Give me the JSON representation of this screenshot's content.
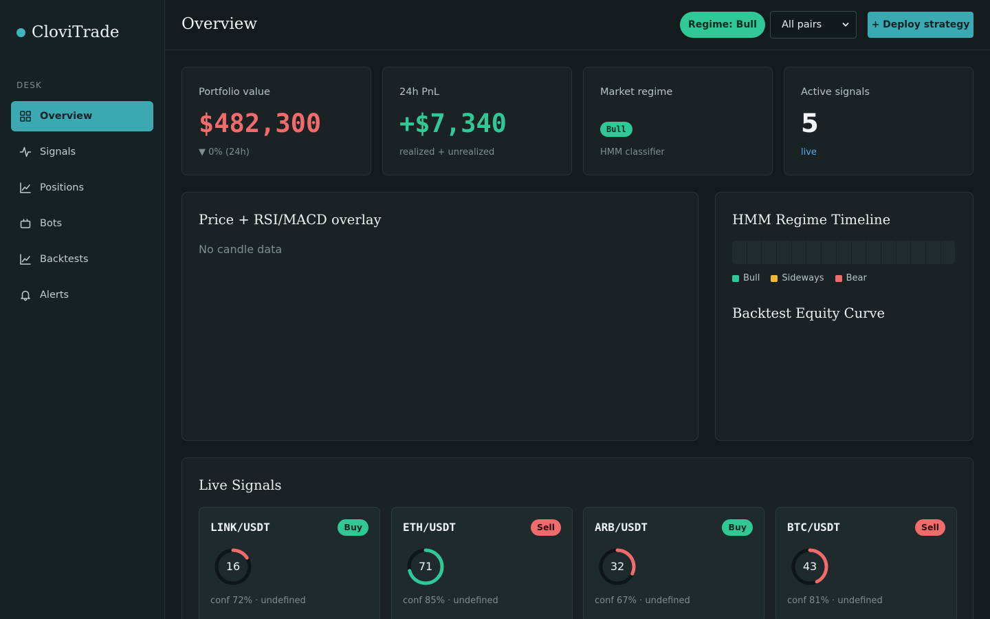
{
  "brand": {
    "name": "CloviTrade"
  },
  "sidebar": {
    "section": "DESK",
    "items": [
      {
        "label": "Overview",
        "icon": "grid-icon",
        "active": true
      },
      {
        "label": "Signals",
        "icon": "activity-icon"
      },
      {
        "label": "Positions",
        "icon": "line-chart-icon"
      },
      {
        "label": "Bots",
        "icon": "bot-icon"
      },
      {
        "label": "Backtests",
        "icon": "line-chart-icon"
      },
      {
        "label": "Alerts",
        "icon": "bell-icon"
      }
    ]
  },
  "header": {
    "title": "Overview",
    "regime_pill": "Regime: Bull",
    "pairs_select": "All pairs",
    "deploy_button": "+ Deploy strategy"
  },
  "stats": {
    "portfolio": {
      "label": "Portfolio value",
      "value": "$482,300",
      "sub": "▼ 0% (24h)"
    },
    "pnl": {
      "label": "24h PnL",
      "value": "+$7,340",
      "sub": "realized + unrealized"
    },
    "regime": {
      "label": "Market regime",
      "badge": "Bull",
      "sub": "HMM classifier"
    },
    "signals": {
      "label": "Active signals",
      "value": "5",
      "sub": "live"
    }
  },
  "price_panel": {
    "title": "Price + RSI/MACD overlay",
    "empty": "No candle data"
  },
  "regime_panel": {
    "title": "HMM Regime Timeline",
    "segments": 15,
    "legend": [
      {
        "label": "Bull",
        "color": "#2fc896"
      },
      {
        "label": "Sideways",
        "color": "#f2b53a"
      },
      {
        "label": "Bear",
        "color": "#f06c6c"
      }
    ],
    "equity_title": "Backtest Equity Curve"
  },
  "live_signals": {
    "title": "Live Signals",
    "cards": [
      {
        "pair": "LINK/USDT",
        "side": "Buy",
        "score": 16,
        "meta": "conf 72% · undefined"
      },
      {
        "pair": "ETH/USDT",
        "side": "Sell",
        "score": 71,
        "meta": "conf 85% · undefined"
      },
      {
        "pair": "ARB/USDT",
        "side": "Buy",
        "score": 32,
        "meta": "conf 67% · undefined"
      },
      {
        "pair": "BTC/USDT",
        "side": "Sell",
        "score": 43,
        "meta": "conf 81% · undefined"
      }
    ]
  },
  "colors": {
    "accent": "#3aa9b2",
    "green": "#2fc896",
    "red": "#f06c6c",
    "track": "#0f1618"
  }
}
